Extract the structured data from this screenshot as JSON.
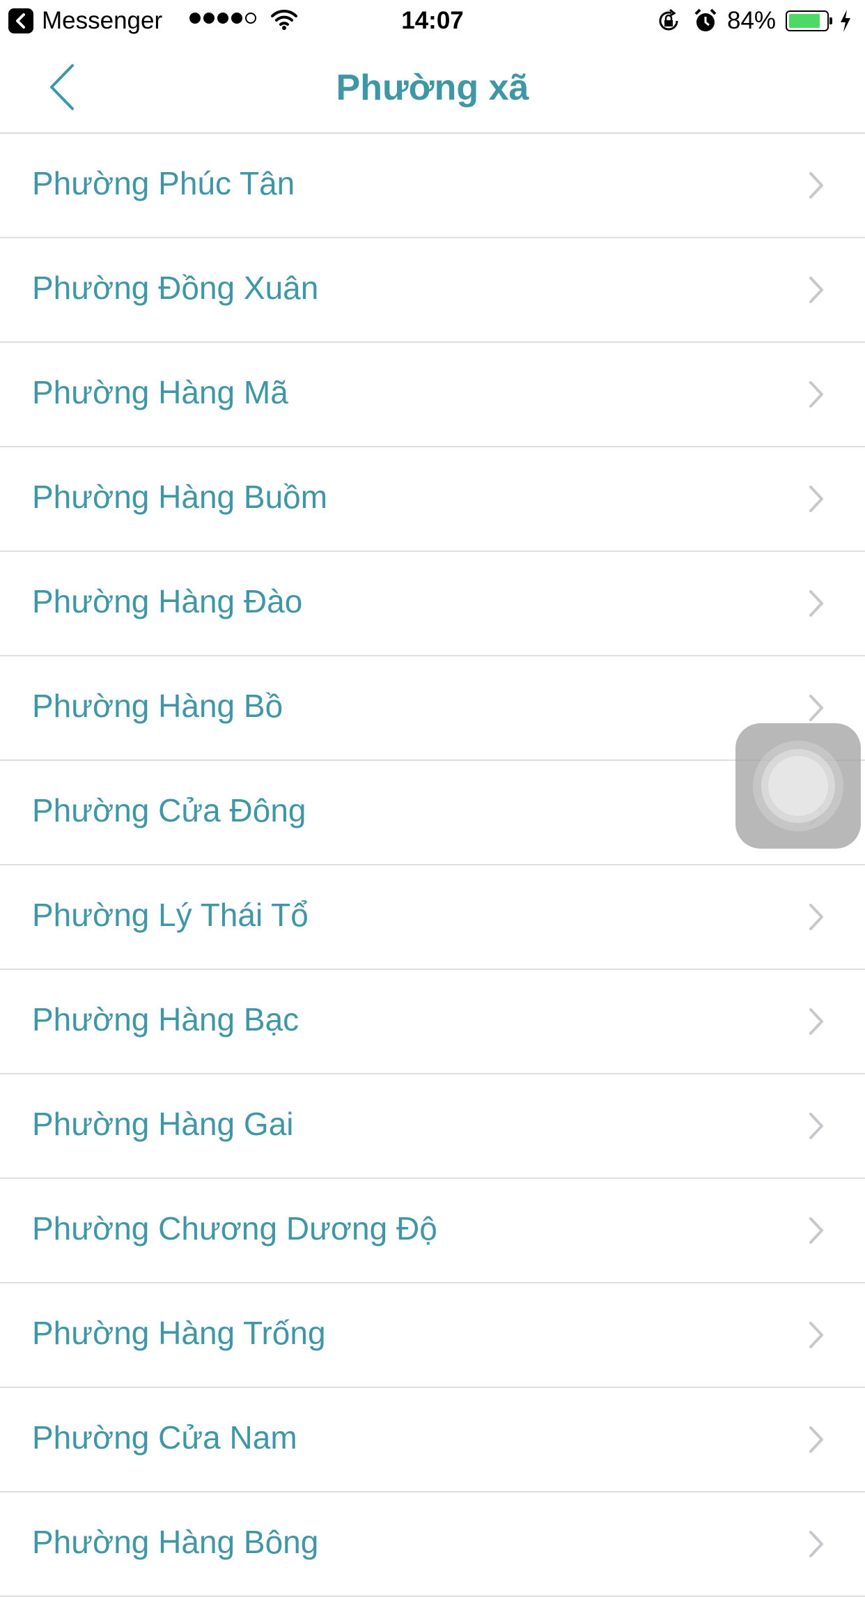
{
  "status_bar": {
    "back_app": "Messenger",
    "time": "14:07",
    "battery_percent": "84%",
    "battery_level": 0.84,
    "signal_bars_filled": 4,
    "signal_bars_total": 5,
    "battery_color": "#4cd964"
  },
  "nav": {
    "title": "Phường xã",
    "back_icon": "chevron-left-icon"
  },
  "accent_color": "#3f97a6",
  "wards": [
    "Phường Phúc Tân",
    "Phường Đồng Xuân",
    "Phường Hàng Mã",
    "Phường Hàng Buồm",
    "Phường Hàng Đào",
    "Phường Hàng Bồ",
    "Phường Cửa Đông",
    "Phường Lý Thái Tổ",
    "Phường Hàng Bạc",
    "Phường Hàng Gai",
    "Phường Chương Dương Độ",
    "Phường Hàng Trống",
    "Phường Cửa Nam",
    "Phường Hàng Bông"
  ]
}
